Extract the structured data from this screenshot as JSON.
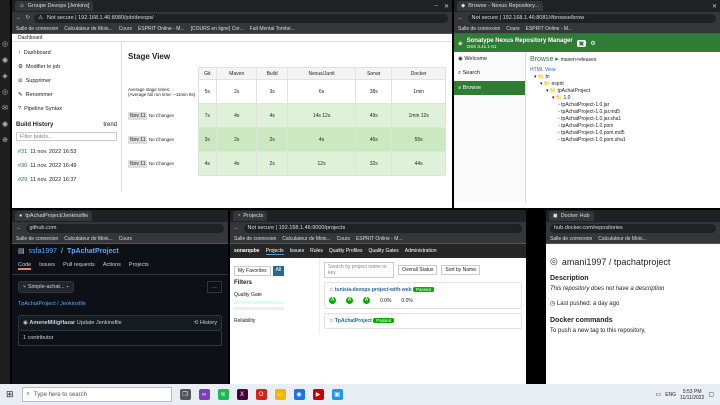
{
  "jenkins": {
    "tab": "Groupe Devops [Jenkins]",
    "url": "Not secure | 192.168.1.46:8080/job/devops/",
    "bookmarks": [
      "Salle de connexion",
      "Calculateur de Mois...",
      "Cours",
      "ESPRIT Online - M...",
      "[COURS en ligne] Cor...",
      "Fait Mental Tombé..."
    ],
    "breadcrumb": "Dashboard",
    "side": [
      "Dashboard",
      "Modifier le job",
      "Supprimer",
      "Renommer",
      "Pipeline Syntax"
    ],
    "build_history": "Build History",
    "trend": "trend",
    "filter_placeholder": "Filter builds...",
    "builds": [
      {
        "id": "#31",
        "date": "11 nov. 2022 16:53"
      },
      {
        "id": "#30",
        "date": "11 nov. 2022 16:49"
      },
      {
        "id": "#29",
        "date": "11 nov. 2022 16:37"
      }
    ],
    "stage_title": "Stage View",
    "avg_label": "Average stage times:",
    "avg_label2": "(Average full run time: ~11min 8s)",
    "stages": [
      "Git",
      "Maven",
      "Build",
      "Nexus/Junit",
      "Sonar",
      "Docker"
    ],
    "averages": [
      "5s",
      "2s",
      "3s",
      "6s",
      "38s",
      "1min"
    ],
    "rows": [
      {
        "label": "Nov 11",
        "changes": "No Changes",
        "cells": [
          "7s",
          "4s",
          "4s",
          "14s 12s",
          "49s",
          "1min 12s"
        ]
      },
      {
        "label": "Nov 11",
        "changes": "No Changes",
        "cells": [
          "3s",
          "2s",
          "2s",
          "4s",
          "46s",
          "55s"
        ]
      },
      {
        "label": "Nov 11",
        "changes": "No Changes",
        "cells": [
          "4s",
          "4s",
          "2s",
          "12s",
          "32s",
          "44s"
        ]
      }
    ]
  },
  "nexus": {
    "tab": "Browse - Nexus Repository...",
    "url": "Not secure | 192.168.1.46:8081/#browse/brow",
    "title": "Sonatype Nexus Repository Manager",
    "version": "OSS 3.41.1-01",
    "side": [
      "Welcome",
      "Search",
      "Browse"
    ],
    "heading": "Browse",
    "repo": "maven-releases",
    "html_view": "HTML View",
    "tree": [
      "tn",
      "esprit",
      "tpAchatProject",
      "1.0",
      "tpAchatProject-1.0.jar",
      "tpAchatProject-1.0.jar.md5",
      "tpAchatProject-1.0.jar.sha1",
      "tpAchatProject-1.0.pom",
      "tpAchatProject-1.0.pom.md5",
      "tpAchatProject-1.0.pom.sha1"
    ]
  },
  "github": {
    "tab": "tpAchatProject/Jenkinsfile",
    "url": "github.com",
    "repo_owner": "ssfa1997",
    "repo_name": "TpAchatProject",
    "tabs": [
      "Code",
      "Issues",
      "Pull requests",
      "Actions",
      "Projects"
    ],
    "branch": "Simple-achat...",
    "path": "TpAchatProject / Jenkinsfile",
    "commit_user": "AmeneMiligHazar",
    "commit_msg": "Update Jenkinsfile",
    "history": "History",
    "contributor": "1 contributor"
  },
  "sonar": {
    "tab": "Projects",
    "url": "Not secure | 192.168.1.46:9000/projects",
    "nav": [
      "sonarqube",
      "Projects",
      "Issues",
      "Rules",
      "Quality Profiles",
      "Quality Gates",
      "Administration"
    ],
    "favorites": "My Favorites",
    "all": "All",
    "search_placeholder": "Search by project name or key",
    "perspective": "Overall Status",
    "sort": "Sort by Name",
    "filters": "Filters",
    "quality_gate": "Quality Gate",
    "reliability": "Reliability",
    "projects": [
      {
        "name": "tunisia-devops-project-with-web",
        "status": "Passed",
        "coverage": "0.0%",
        "dup": "0.0%"
      },
      {
        "name": "TpAchatProject",
        "status": "Passed",
        "coverage": "0.0%",
        "dup": "0.0%"
      }
    ]
  },
  "docker": {
    "tab": "Docker Hub",
    "url": "hub.docker.com/repositories",
    "repo": "amani1997 / tpachatproject",
    "desc_title": "Description",
    "desc": "This repository does not have a description",
    "pushed": "Last pushed: a day ago",
    "commands_title": "Docker commands",
    "commands_desc": "To push a new tag to this repository,"
  },
  "taskbar": {
    "search": "Type here to search",
    "time": "5:53 PM",
    "date": "11/11/2022",
    "lang": "ENG"
  }
}
